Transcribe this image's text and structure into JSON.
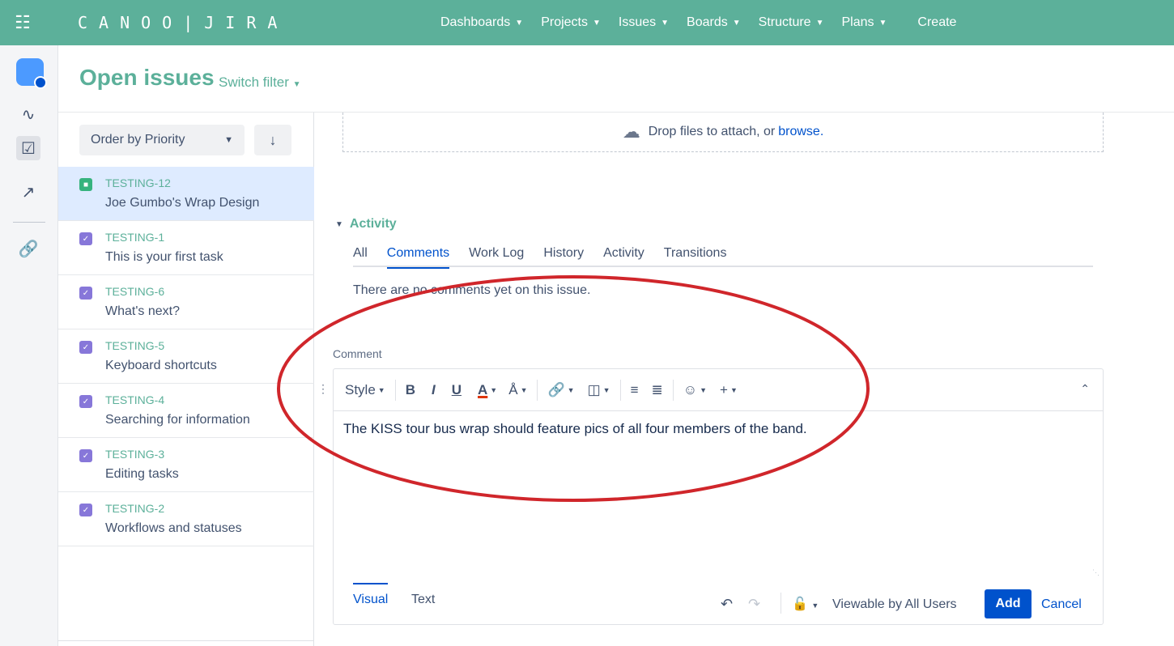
{
  "topbar": {
    "brand": "CANOO|JIRA",
    "nav": [
      {
        "label": "Dashboards"
      },
      {
        "label": "Projects"
      },
      {
        "label": "Issues"
      },
      {
        "label": "Boards"
      },
      {
        "label": "Structure"
      },
      {
        "label": "Plans"
      }
    ],
    "create_label": "Create"
  },
  "header": {
    "title": "Open issues",
    "switch_filter": "Switch filter"
  },
  "list": {
    "order_label": "Order by Priority",
    "issues": [
      {
        "key": "TESTING-12",
        "summary": "Joe Gumbo's Wrap Design",
        "type": "story"
      },
      {
        "key": "TESTING-1",
        "summary": "This is your first task",
        "type": "task"
      },
      {
        "key": "TESTING-6",
        "summary": "What's next?",
        "type": "task"
      },
      {
        "key": "TESTING-5",
        "summary": "Keyboard shortcuts",
        "type": "task"
      },
      {
        "key": "TESTING-4",
        "summary": "Searching for information",
        "type": "task"
      },
      {
        "key": "TESTING-3",
        "summary": "Editing tasks",
        "type": "task"
      },
      {
        "key": "TESTING-2",
        "summary": "Workflows and statuses",
        "type": "task"
      }
    ]
  },
  "attach": {
    "text": "Drop files to attach, or",
    "browse": "browse."
  },
  "activity": {
    "heading": "Activity",
    "tabs": [
      {
        "label": "All"
      },
      {
        "label": "Comments"
      },
      {
        "label": "Work Log"
      },
      {
        "label": "History"
      },
      {
        "label": "Activity"
      },
      {
        "label": "Transitions"
      }
    ],
    "empty_text": "There are no comments yet on this issue."
  },
  "comment": {
    "label": "Comment",
    "style_label": "Style",
    "text": "The KISS tour bus wrap should feature pics of all four members of the band.",
    "mode_visual": "Visual",
    "mode_text": "Text",
    "visibility": "Viewable by All Users",
    "add_label": "Add",
    "cancel_label": "Cancel"
  },
  "colors": {
    "brand": "#5cb09a",
    "link": "#0052cc",
    "annotation": "#d0262b"
  }
}
